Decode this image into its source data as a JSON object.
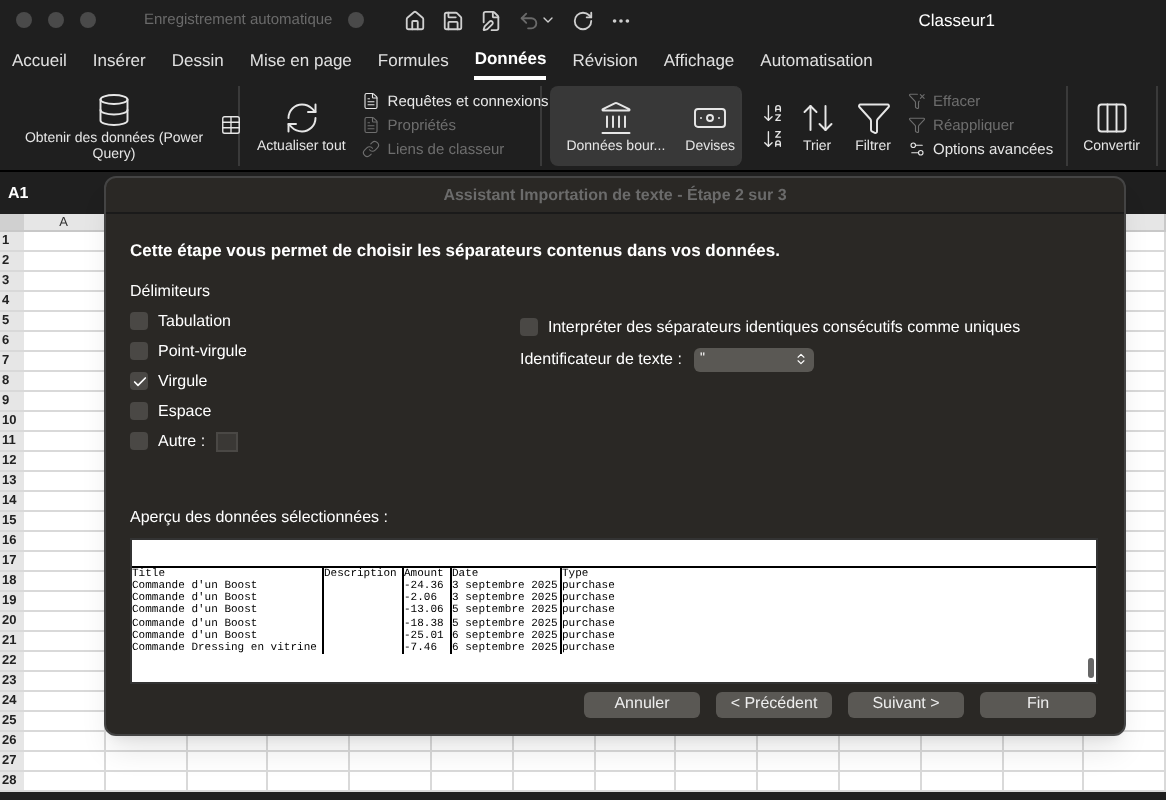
{
  "window": {
    "autosave_label": "Enregistrement automatique",
    "title": "Classeur1"
  },
  "ribbon_tabs": [
    {
      "label": "Accueil",
      "selected": false
    },
    {
      "label": "Insérer",
      "selected": false
    },
    {
      "label": "Dessin",
      "selected": false
    },
    {
      "label": "Mise en page",
      "selected": false
    },
    {
      "label": "Formules",
      "selected": false
    },
    {
      "label": "Données",
      "selected": true
    },
    {
      "label": "Révision",
      "selected": false
    },
    {
      "label": "Affichage",
      "selected": false
    },
    {
      "label": "Automatisation",
      "selected": false
    }
  ],
  "ribbon_groups": [
    {
      "highlighted": false,
      "items": [
        {
          "kind": "large",
          "label": "Obtenir des données (Power Query)",
          "disabled": false
        },
        {
          "kind": "icon",
          "disabled": false
        }
      ]
    },
    {
      "highlighted": false,
      "items": [
        {
          "kind": "large",
          "label": "Actualiser tout",
          "disabled": false
        },
        {
          "kind": "small",
          "label": "Requêtes et connexions",
          "disabled": false
        },
        {
          "kind": "small",
          "label": "Propriétés",
          "disabled": true
        },
        {
          "kind": "small",
          "label": "Liens de classeur",
          "disabled": true
        }
      ]
    },
    {
      "highlighted": true,
      "items": [
        {
          "kind": "large",
          "label": "Données bour...",
          "disabled": false
        },
        {
          "kind": "large",
          "label": "Devises",
          "disabled": false
        }
      ]
    },
    {
      "highlighted": false,
      "items": [
        {
          "kind": "icon",
          "disabled": false
        },
        {
          "kind": "icon",
          "disabled": false
        },
        {
          "kind": "large",
          "label": "Trier",
          "disabled": false
        },
        {
          "kind": "large",
          "label": "Filtrer",
          "disabled": false
        },
        {
          "kind": "small",
          "label": "Effacer",
          "disabled": true
        },
        {
          "kind": "small",
          "label": "Réappliquer",
          "disabled": true
        },
        {
          "kind": "small",
          "label": "Options avancées",
          "disabled": false
        }
      ]
    },
    {
      "highlighted": false,
      "items": [
        {
          "kind": "large",
          "label": "Convertir",
          "disabled": false
        }
      ]
    }
  ],
  "name_box": "A1",
  "sheet": {
    "columns": [
      "A"
    ],
    "rows": [
      "1",
      "2",
      "3",
      "4",
      "5",
      "6",
      "7",
      "8",
      "9",
      "10",
      "11",
      "12",
      "13",
      "14",
      "15",
      "16",
      "17",
      "18",
      "19",
      "20",
      "21",
      "22",
      "23",
      "24",
      "25",
      "26",
      "27",
      "28"
    ]
  },
  "dialog": {
    "title": "Assistant Importation de texte - Étape 2 sur 3",
    "instruction": "Cette étape vous permet de choisir les séparateurs contenus dans vos données.",
    "delimiters_label": "Délimiteurs",
    "delimiters": [
      {
        "kind": "check",
        "label": "Tabulation",
        "checked": false
      },
      {
        "kind": "check",
        "label": "Point-virgule",
        "checked": false
      },
      {
        "kind": "check",
        "label": "Virgule",
        "checked": true
      },
      {
        "kind": "check",
        "label": "Espace",
        "checked": false
      },
      {
        "kind": "other",
        "label": "Autre :",
        "checked": false
      }
    ],
    "consecutive": {
      "label": "Interpréter des séparateurs identiques consécutifs comme uniques",
      "checked": false
    },
    "qualifier": {
      "label": "Identificateur de texte :",
      "value": "\""
    },
    "preview_label": "Aperçu des données sélectionnées :",
    "preview": {
      "columns": [
        "Title",
        "Description",
        "Amount",
        "Date",
        "Type"
      ],
      "rows": [
        [
          "Commande d'un Boost",
          "",
          "-24.36",
          "3 septembre 2025",
          "purchase"
        ],
        [
          "Commande d'un Boost",
          "",
          "-2.06",
          "3 septembre 2025",
          "purchase"
        ],
        [
          "Commande d'un Boost",
          "",
          "-13.06",
          "5 septembre 2025",
          "purchase"
        ],
        [
          "Commande d'un Boost",
          "",
          "-18.38",
          "5 septembre 2025",
          "purchase"
        ],
        [
          "Commande d'un Boost",
          "",
          "-25.01",
          "6 septembre 2025",
          "purchase"
        ],
        [
          "Commande Dressing en vitrine",
          "",
          "-7.46",
          "6 septembre 2025",
          "purchase"
        ]
      ]
    },
    "buttons": [
      "Annuler",
      "< Précédent",
      "Suivant >",
      "Fin"
    ]
  }
}
